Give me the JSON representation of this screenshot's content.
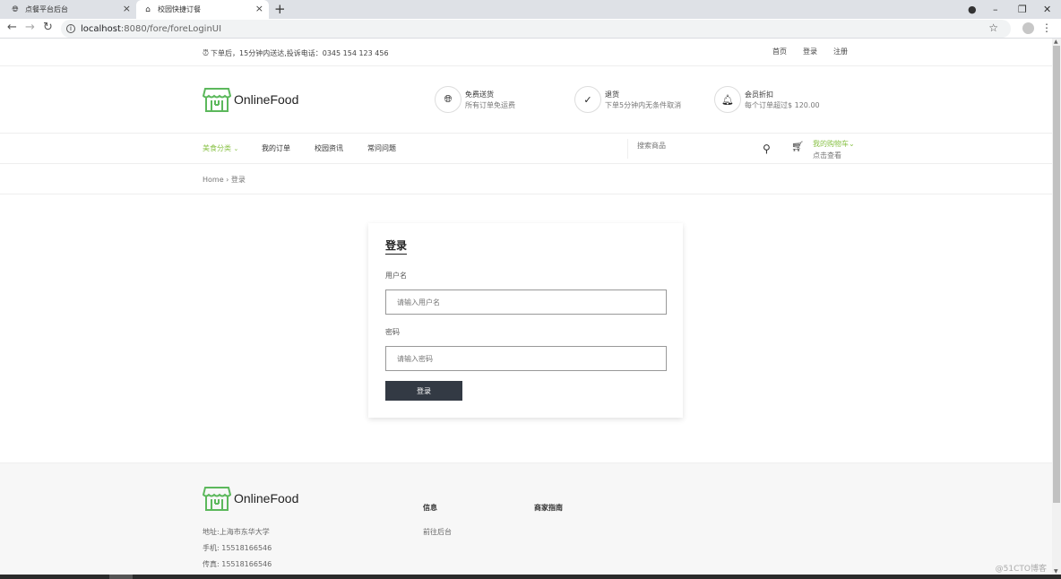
{
  "browser": {
    "tabs": [
      {
        "label": "点餐平台后台",
        "icon": "globe-icon"
      },
      {
        "label": "校园快捷订餐",
        "icon": "store-icon"
      }
    ],
    "url_host": "localhost",
    "url_path": ":8080/fore/foreLoginUI"
  },
  "topbar": {
    "notice": "下单后，15分钟内送达,投诉电话：0345 154 123 456",
    "links": [
      "首页",
      "登录",
      "注册"
    ]
  },
  "header": {
    "logo_text": "OnlineFood",
    "features": [
      {
        "title": "免费送货",
        "subtitle": "所有订单免运费",
        "icon": "globe-icon"
      },
      {
        "title": "退货",
        "subtitle": "下单5分钟内无条件取消",
        "icon": "check-circle-icon"
      },
      {
        "title": "会员折扣",
        "subtitle": "每个订单超过$ 120.00",
        "icon": "bell-icon"
      }
    ]
  },
  "nav": {
    "items": [
      "美食分类",
      "我的订单",
      "校园资讯",
      "常问问题"
    ],
    "search_placeholder": "搜索商品",
    "cart_title": "我的购物车",
    "cart_sub": "点击查看"
  },
  "breadcrumb": {
    "home": "Home",
    "current": "登录"
  },
  "login": {
    "title": "登录",
    "username_label": "用户名",
    "username_placeholder": "请输入用户名",
    "password_label": "密码",
    "password_placeholder": "请输入密码",
    "submit_label": "登录"
  },
  "footer": {
    "logo_text": "OnlineFood",
    "address": "地址:上海市东华大学",
    "phone": "手机: 15518166546",
    "fax": "传真: 15518166546",
    "col1_title": "信息",
    "col1_link": "前往后台",
    "col2_title": "商家指南"
  },
  "watermark": "@51CTO博客",
  "colors": {
    "accent": "#8bc34a",
    "button": "#333a44"
  }
}
